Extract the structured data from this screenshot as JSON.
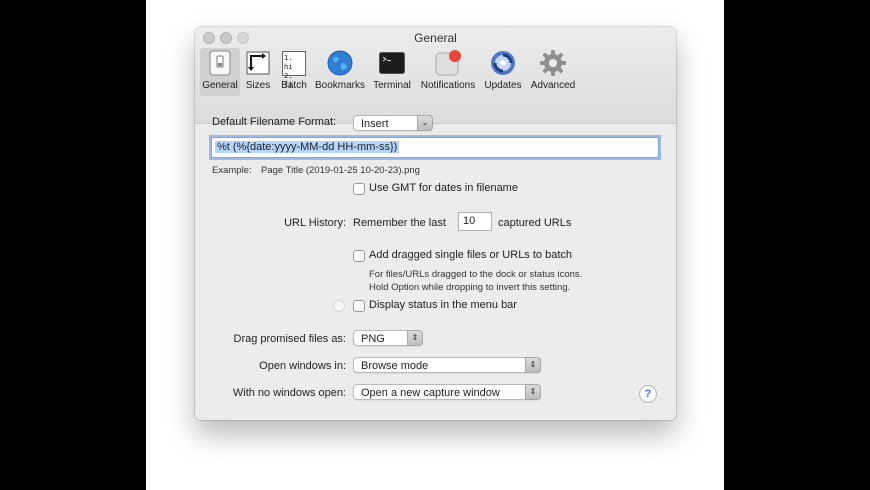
{
  "window": {
    "title": "General"
  },
  "toolbar": {
    "items": [
      {
        "label": "General",
        "icon": "general-icon"
      },
      {
        "label": "Sizes",
        "icon": "sizes-icon"
      },
      {
        "label": "Batch",
        "icon": "batch-icon",
        "icon_text_1": "1. hi",
        "icon_text_2": "2. fi"
      },
      {
        "label": "Bookmarks",
        "icon": "globe-icon"
      },
      {
        "label": "Terminal",
        "icon": "terminal-icon"
      },
      {
        "label": "Notifications",
        "icon": "notifications-icon"
      },
      {
        "label": "Updates",
        "icon": "updates-icon"
      },
      {
        "label": "Advanced",
        "icon": "gear-icon"
      }
    ]
  },
  "general": {
    "filename_format_label": "Default Filename Format:",
    "insert_popup": "Insert",
    "filename_value": "%t (%{date:yyyy-MM-dd HH-mm-ss})",
    "example_label": "Example:",
    "example_value": "Page Title (2019-01-25 10-20-23).png",
    "use_gmt_label": "Use GMT for dates in filename",
    "url_history_label": "URL History:",
    "remember_prefix": "Remember the last",
    "url_history_count": "10",
    "remember_suffix": "captured URLs",
    "add_dragged_label": "Add dragged single files or URLs to batch",
    "add_dragged_note_1": "For files/URLs dragged to the dock or status icons.",
    "add_dragged_note_2": "Hold Option while dropping to invert this setting.",
    "display_status_label": "Display status in the menu bar",
    "drag_promised_label": "Drag promised files as:",
    "drag_promised_value": "PNG",
    "open_windows_label": "Open windows in:",
    "open_windows_value": "Browse mode",
    "no_windows_label": "With no windows open:",
    "no_windows_value": "Open a new capture window",
    "help_glyph": "?"
  },
  "colors": {
    "selection": "#b4d5fe",
    "window_bg": "#ececec",
    "notification_badge": "#e8453c"
  }
}
